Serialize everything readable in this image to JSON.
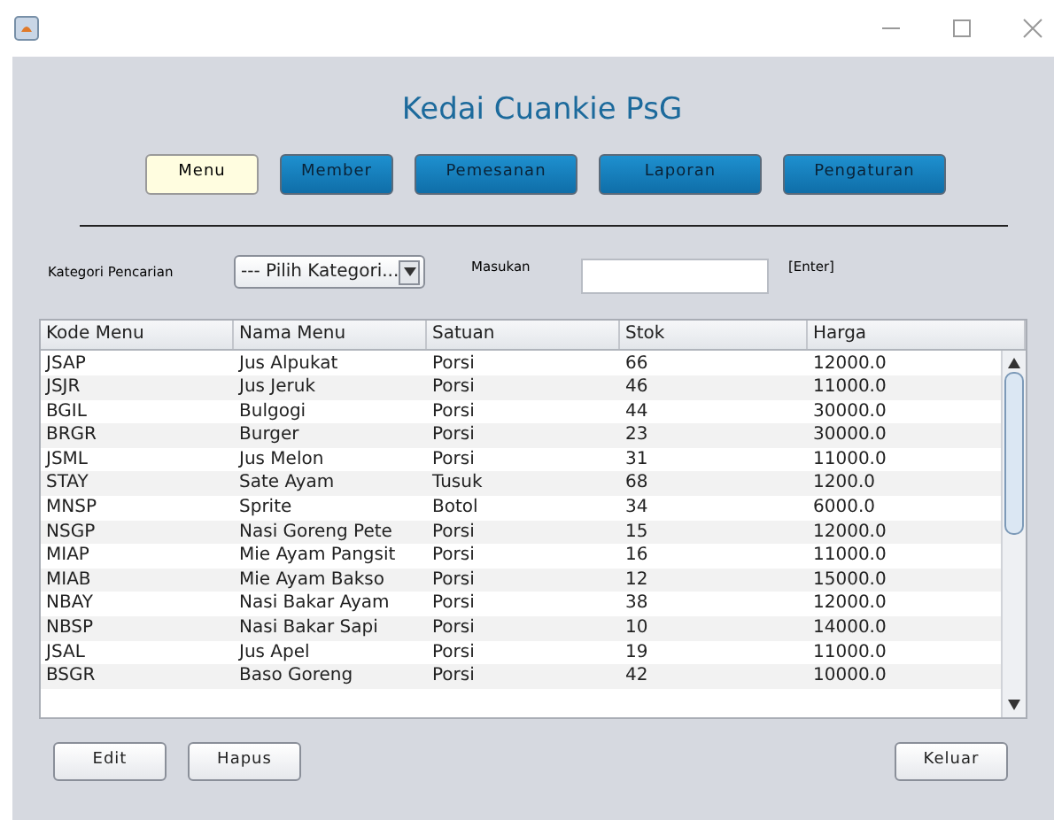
{
  "app_title": "Kedai Cuankie PsG",
  "nav": [
    {
      "label": "Menu",
      "selected": true
    },
    {
      "label": "Member",
      "selected": false
    },
    {
      "label": "Pemesanan",
      "selected": false
    },
    {
      "label": "Laporan",
      "selected": false
    },
    {
      "label": "Pengaturan",
      "selected": false
    }
  ],
  "search": {
    "category_label": "Kategori Pencarian",
    "category_value": "--- Pilih Kategori...",
    "input_label": "Masukan",
    "hint": "[Enter]"
  },
  "table": {
    "columns": [
      "Kode Menu",
      "Nama Menu",
      "Satuan",
      "Stok",
      "Harga"
    ],
    "rows": [
      [
        "JSAP",
        "Jus Alpukat",
        "Porsi",
        "66",
        "12000.0"
      ],
      [
        "JSJR",
        "Jus Jeruk",
        "Porsi",
        "46",
        "11000.0"
      ],
      [
        "BGIL",
        "Bulgogi",
        "Porsi",
        "44",
        "30000.0"
      ],
      [
        "BRGR",
        "Burger",
        "Porsi",
        "23",
        "30000.0"
      ],
      [
        "JSML",
        "Jus Melon",
        "Porsi",
        "31",
        "11000.0"
      ],
      [
        "STAY",
        "Sate Ayam",
        "Tusuk",
        "68",
        "1200.0"
      ],
      [
        "MNSP",
        "Sprite",
        "Botol",
        "34",
        "6000.0"
      ],
      [
        "NSGP",
        "Nasi Goreng Pete",
        "Porsi",
        "15",
        "12000.0"
      ],
      [
        "MIAP",
        "Mie Ayam Pangsit",
        "Porsi",
        "16",
        "11000.0"
      ],
      [
        "MIAB",
        "Mie Ayam Bakso",
        "Porsi",
        "12",
        "15000.0"
      ],
      [
        "NBAY",
        "Nasi Bakar Ayam",
        "Porsi",
        "38",
        "12000.0"
      ],
      [
        "NBSP",
        "Nasi Bakar Sapi",
        "Porsi",
        "10",
        "14000.0"
      ],
      [
        "JSAL",
        "Jus Apel",
        "Porsi",
        "19",
        "11000.0"
      ],
      [
        "BSGR",
        "Baso Goreng",
        "Porsi",
        "42",
        "10000.0"
      ]
    ]
  },
  "footer_buttons": {
    "left": [
      "Edit",
      "Hapus"
    ],
    "right": [
      "Keluar"
    ]
  }
}
